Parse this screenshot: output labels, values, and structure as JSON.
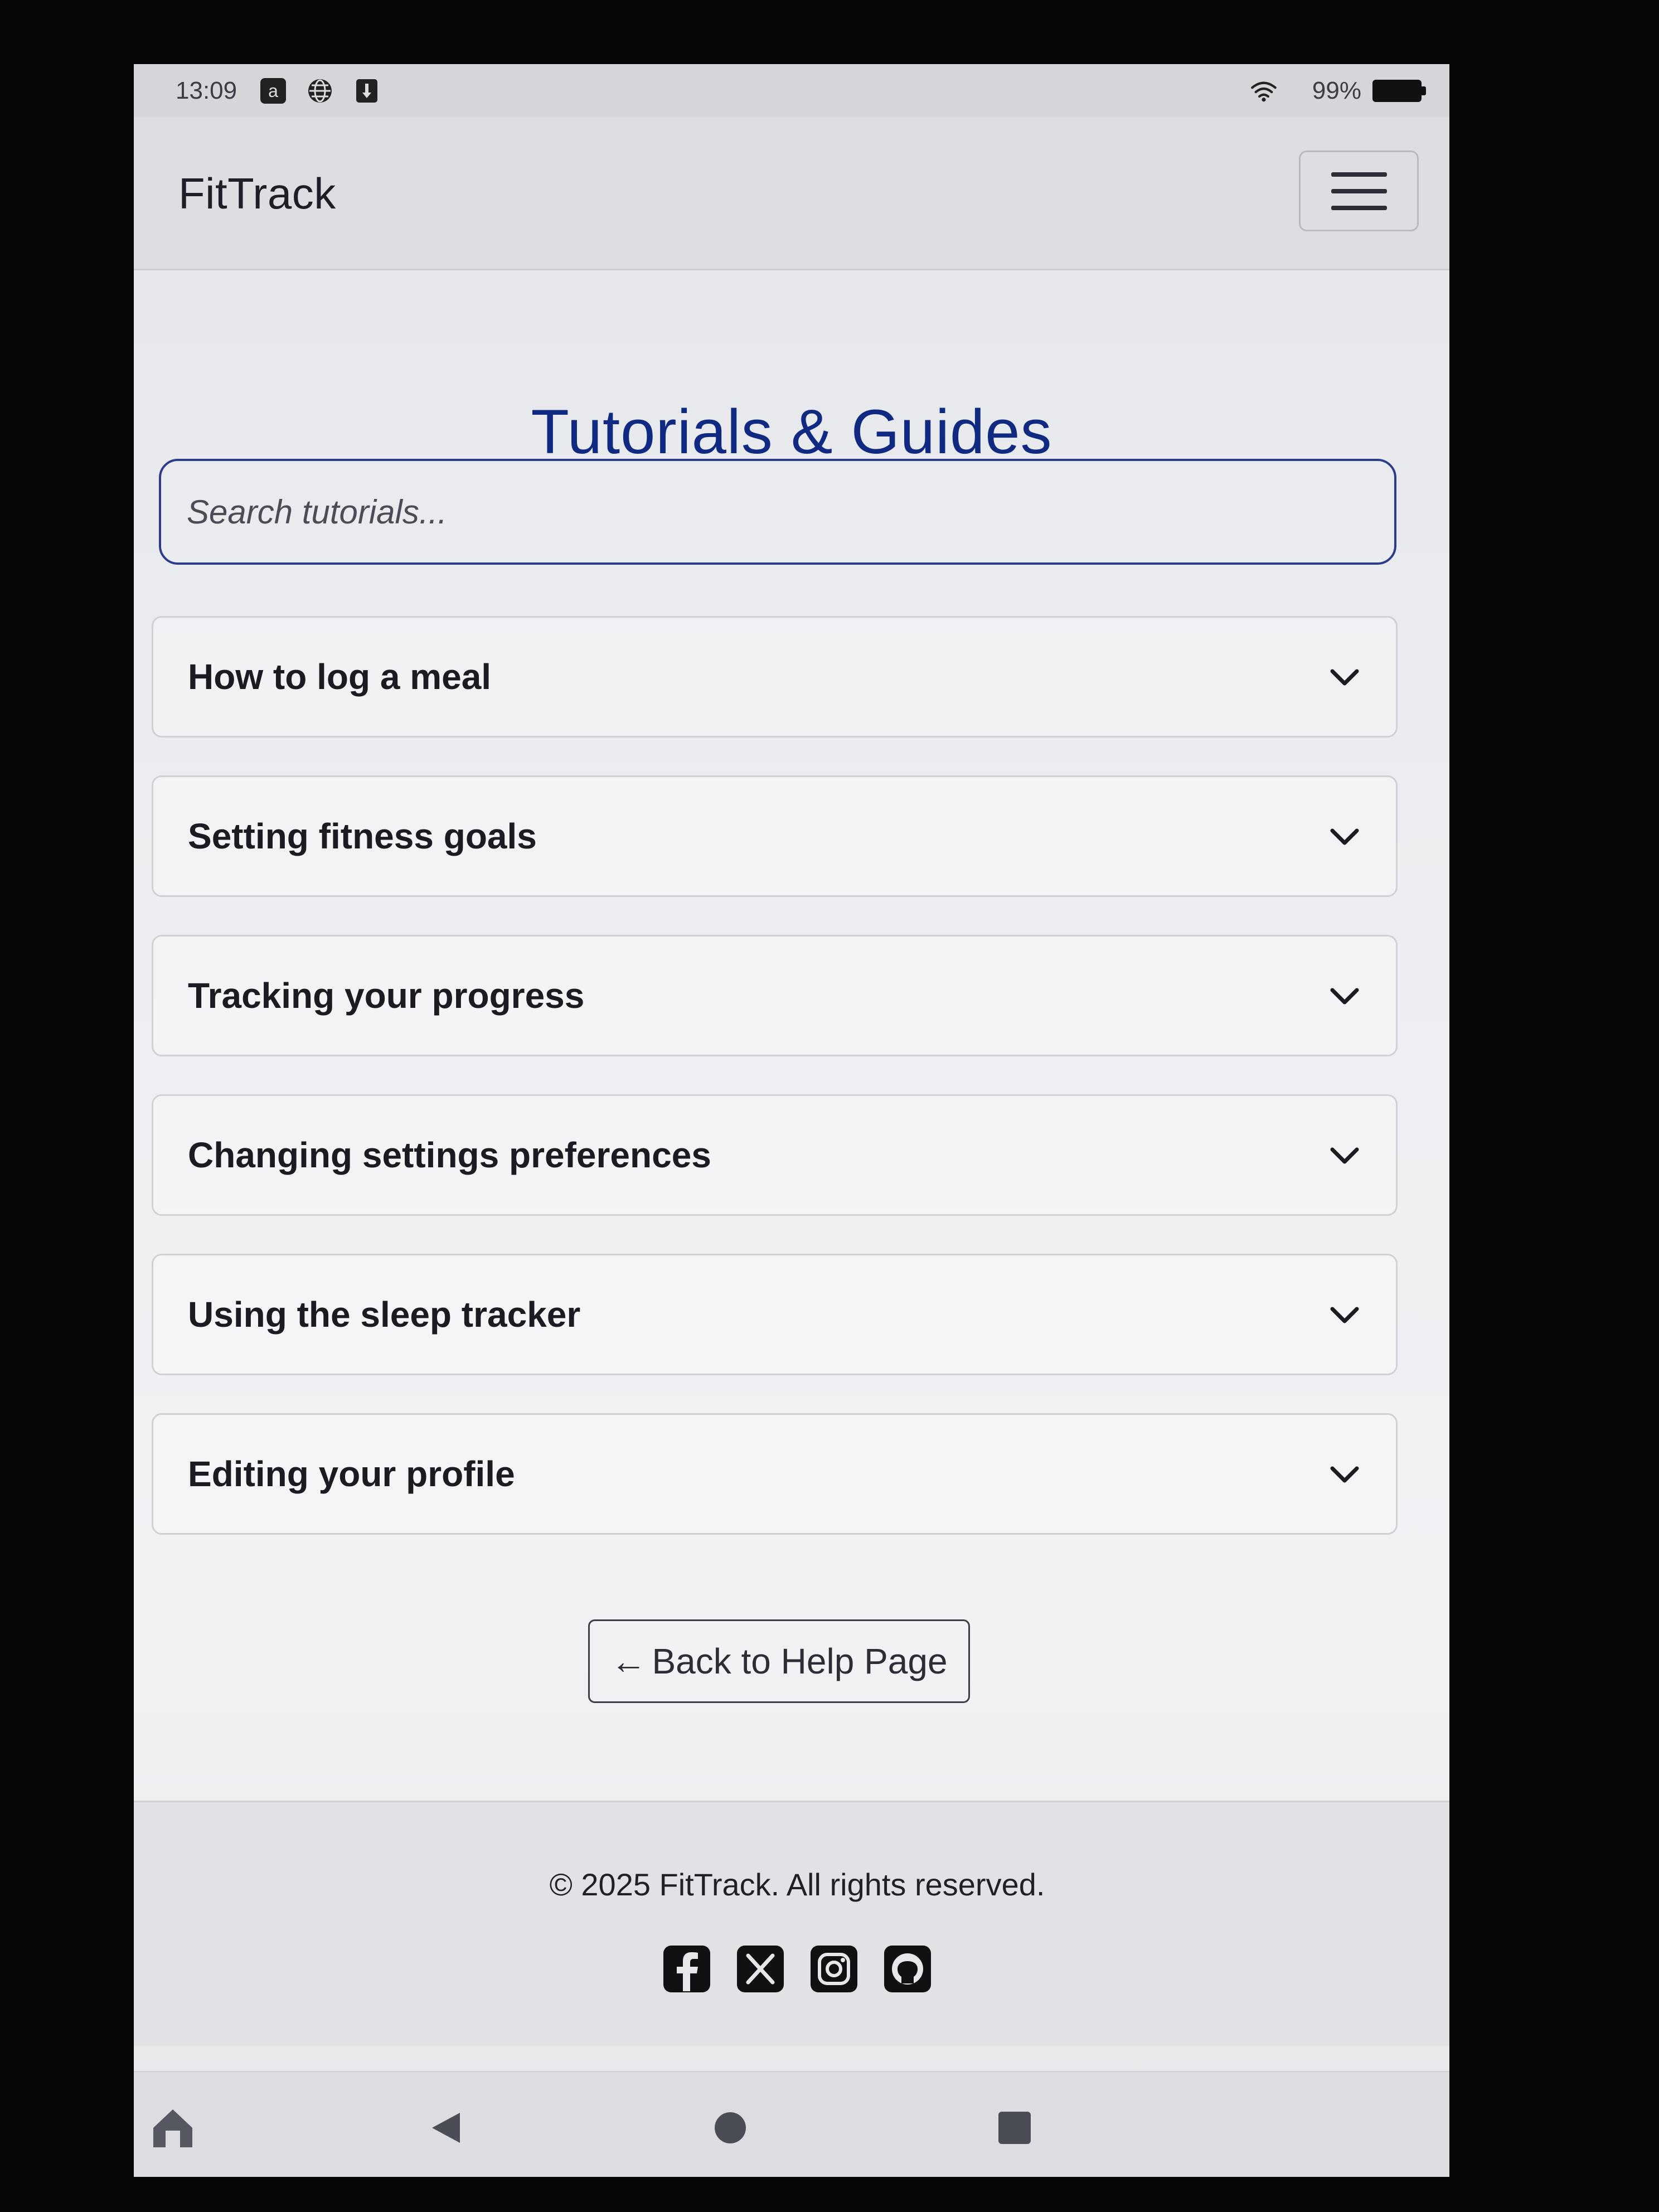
{
  "status_bar": {
    "time": "13:09",
    "battery": "99%",
    "icons": [
      "amazon-icon",
      "globe-icon",
      "download-icon",
      "wifi-icon",
      "battery-icon"
    ]
  },
  "navbar": {
    "brand": "FitTrack",
    "menu_icon": "hamburger-icon"
  },
  "page": {
    "title": "Tutorials & Guides"
  },
  "search": {
    "placeholder": "Search tutorials..."
  },
  "tutorials": [
    {
      "label": "How to log a meal"
    },
    {
      "label": "Setting fitness goals"
    },
    {
      "label": "Tracking your progress"
    },
    {
      "label": "Changing settings preferences"
    },
    {
      "label": "Using the sleep tracker"
    },
    {
      "label": "Editing your profile"
    }
  ],
  "back_button": {
    "arrow": "←",
    "label": "Back to Help Page"
  },
  "footer": {
    "copyright": "© 2025 FitTrack. All rights reserved.",
    "social": [
      "facebook-icon",
      "x-icon",
      "instagram-icon",
      "github-icon"
    ]
  },
  "system_nav": [
    "home-icon",
    "back-icon",
    "home-circle-icon",
    "recents-icon"
  ],
  "colors": {
    "title": "#0f2a80",
    "search_border": "#2a3c8a",
    "text": "#1a1c22"
  }
}
